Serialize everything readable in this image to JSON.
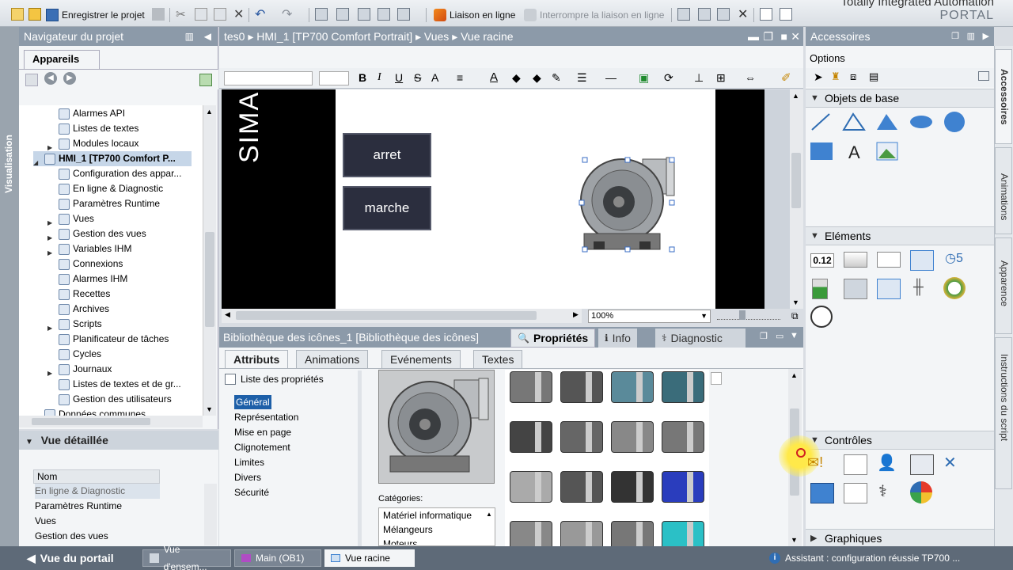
{
  "app": {
    "title": "Totally Integrated Automation",
    "subtitle": "PORTAL"
  },
  "toolbar": {
    "save_project": "Enregistrer le projet",
    "go_online": "Liaison en ligne",
    "go_offline": "Interrompre la liaison en ligne"
  },
  "left_vtab": "Visualisation",
  "navigator": {
    "title": "Navigateur du projet",
    "tab": "Appareils",
    "items": [
      {
        "label": "Alarmes API",
        "indent": 2,
        "expand": false
      },
      {
        "label": "Listes de textes",
        "indent": 2,
        "expand": false
      },
      {
        "label": "Modules locaux",
        "indent": 2,
        "expand": true
      },
      {
        "label": "HMI_1 [TP700 Comfort P...",
        "indent": 1,
        "expand": true,
        "open": true,
        "bold": true
      },
      {
        "label": "Configuration des appar...",
        "indent": 2,
        "expand": false
      },
      {
        "label": "En ligne & Diagnostic",
        "indent": 2,
        "expand": false
      },
      {
        "label": "Paramètres Runtime",
        "indent": 2,
        "expand": false
      },
      {
        "label": "Vues",
        "indent": 2,
        "expand": true
      },
      {
        "label": "Gestion des vues",
        "indent": 2,
        "expand": true
      },
      {
        "label": "Variables IHM",
        "indent": 2,
        "expand": true
      },
      {
        "label": "Connexions",
        "indent": 2,
        "expand": false
      },
      {
        "label": "Alarmes IHM",
        "indent": 2,
        "expand": false
      },
      {
        "label": "Recettes",
        "indent": 2,
        "expand": false
      },
      {
        "label": "Archives",
        "indent": 2,
        "expand": false
      },
      {
        "label": "Scripts",
        "indent": 2,
        "expand": true
      },
      {
        "label": "Planificateur de tâches",
        "indent": 2,
        "expand": false
      },
      {
        "label": "Cycles",
        "indent": 2,
        "expand": false
      },
      {
        "label": "Journaux",
        "indent": 2,
        "expand": true
      },
      {
        "label": "Listes de textes et de gr...",
        "indent": 2,
        "expand": false
      },
      {
        "label": "Gestion des utilisateurs",
        "indent": 2,
        "expand": false
      },
      {
        "label": "Données communes",
        "indent": 1,
        "expand": true
      }
    ]
  },
  "detail": {
    "title": "Vue détaillée",
    "column": "Nom",
    "rows": [
      "En ligne & Diagnostic",
      "Paramètres Runtime",
      "Vues",
      "Gestion des vues"
    ]
  },
  "editor": {
    "breadcrumb": "tes0  ▸  HMI_1 [TP700 Comfort Portrait]  ▸  Vues  ▸  Vue racine",
    "hmi_brand": "SIMA",
    "btn_stop": "arret",
    "btn_start": "marche",
    "zoom": "100%"
  },
  "bottom": {
    "library_title": "Bibliothèque des icônes_1 [Bibliothèque des icônes]",
    "tabs": [
      "Propriétés",
      "Info",
      "Diagnostic"
    ],
    "prop_tabs": [
      "Attributs",
      "Animations",
      "Evénements",
      "Textes"
    ],
    "prop_list_header": "Liste des propriétés",
    "prop_list": [
      "Général",
      "Représentation",
      "Mise en page",
      "Clignotement",
      "Limites",
      "Divers",
      "Sécurité"
    ],
    "categories_label": "Catégories:",
    "categories": [
      "Matériel informatique",
      "Mélangeurs",
      "Moteurs"
    ]
  },
  "accessories": {
    "title": "Accessoires",
    "options": "Options",
    "sections": [
      "Objets de base",
      "Eléments",
      "Contrôles",
      "Graphiques"
    ],
    "element_value": "0.12"
  },
  "right_vtabs": [
    "Accessoires",
    "Animations",
    "Apparence",
    "Instructions du script"
  ],
  "statusbar": {
    "portal_view": "Vue du portail",
    "tabs": [
      "Vue d'ensem...",
      "Main (OB1)",
      "Vue racine"
    ],
    "message": "Assistant : configuration réussie TP700 ..."
  }
}
